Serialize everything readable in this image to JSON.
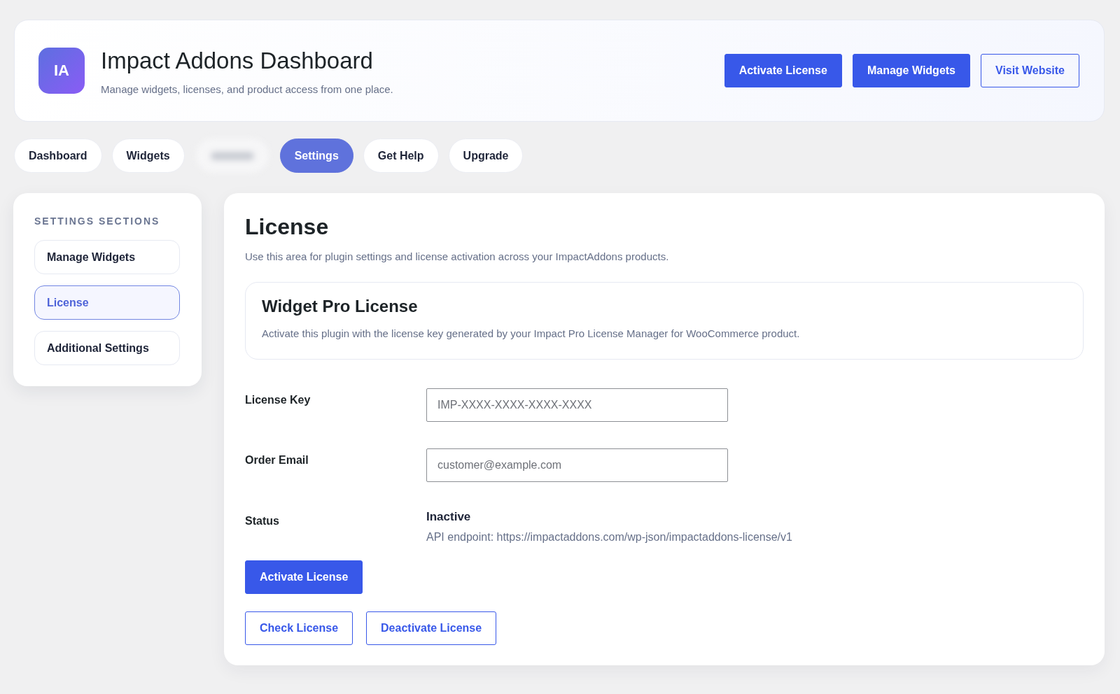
{
  "header": {
    "logo_text": "IA",
    "title": "Impact Addons Dashboard",
    "subtitle": "Manage widgets, licenses, and product access from one place.",
    "buttons": [
      {
        "label": "Activate License",
        "kind": "primary"
      },
      {
        "label": "Manage Widgets",
        "kind": "primary"
      },
      {
        "label": "Visit Website",
        "kind": "outline"
      }
    ]
  },
  "tabs": [
    {
      "kind": "text",
      "label": "Dashboard",
      "selected": false
    },
    {
      "kind": "text",
      "label": "Widgets",
      "selected": false
    },
    {
      "kind": "blurred",
      "selected": false
    },
    {
      "kind": "text",
      "label": "Settings",
      "selected": true
    },
    {
      "kind": "text",
      "label": "Get Help",
      "selected": false
    },
    {
      "kind": "text",
      "label": "Upgrade",
      "selected": false
    }
  ],
  "sidebar": {
    "heading": "SETTINGS SECTIONS",
    "items": [
      {
        "label": "Manage Widgets",
        "selected": false
      },
      {
        "label": "License",
        "selected": true
      },
      {
        "label": "Additional Settings",
        "selected": false
      }
    ]
  },
  "main": {
    "title": "License",
    "description": "Use this area for plugin settings and license activation across your ImpactAddons products.",
    "license_card": {
      "title": "Widget Pro License",
      "description": "Activate this plugin with the license key generated by your Impact Pro License Manager for WooCommerce product."
    },
    "fields": [
      {
        "kind": "input",
        "label": "License Key",
        "placeholder": "IMP-XXXX-XXXX-XXXX-XXXX"
      },
      {
        "kind": "input",
        "label": "Order Email",
        "placeholder": "customer@example.com"
      },
      {
        "kind": "status",
        "label": "Status",
        "value": "Inactive",
        "note": "API endpoint: https://impactaddons.com/wp-json/impactaddons-license/v1"
      }
    ],
    "primary_actions": [
      {
        "label": "Activate License",
        "kind": "primary"
      }
    ],
    "secondary_actions": [
      {
        "label": "Check License",
        "kind": "outline"
      },
      {
        "label": "Deactivate License",
        "kind": "outline"
      }
    ]
  }
}
